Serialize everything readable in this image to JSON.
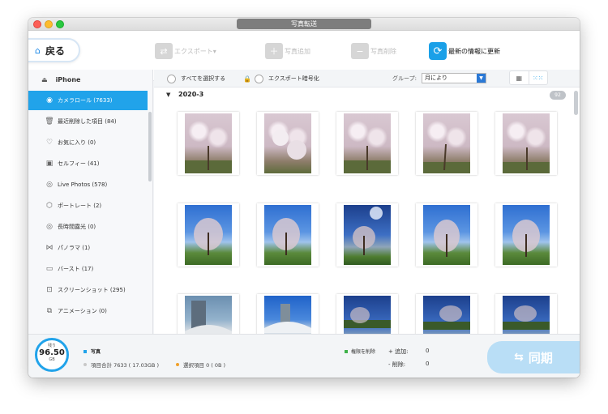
{
  "window": {
    "title": "写真転送"
  },
  "toolbar": {
    "back_label": "戻る",
    "export_label": "エクスポート▾",
    "add_label": "写真追加",
    "delete_label": "写真削除",
    "refresh_label": "最新の情報に更新"
  },
  "sidebar": {
    "device": "iPhone",
    "items": [
      {
        "label": "カメラロール (7633)",
        "icon": "camera-icon",
        "active": true
      },
      {
        "label": "最近削除した項目 (84)",
        "icon": "trash-icon"
      },
      {
        "label": "お気に入り (0)",
        "icon": "heart-icon"
      },
      {
        "label": "セルフィー (41)",
        "icon": "selfie-icon"
      },
      {
        "label": "Live Photos (578)",
        "icon": "live-photo-icon"
      },
      {
        "label": "ポートレート (2)",
        "icon": "cube-icon"
      },
      {
        "label": "長時間露光 (0)",
        "icon": "long-exposure-icon"
      },
      {
        "label": "パノラマ (1)",
        "icon": "panorama-icon"
      },
      {
        "label": "バースト (17)",
        "icon": "burst-icon"
      },
      {
        "label": "スクリーンショット (295)",
        "icon": "screenshot-icon"
      },
      {
        "label": "アニメーション (0)",
        "icon": "animation-icon"
      }
    ]
  },
  "filter": {
    "select_all": "すべてを選択する",
    "export_encrypt": "エクスポート暗号化",
    "group_label": "グループ:",
    "group_value": "月により"
  },
  "gallery": {
    "group_title": "2020-3",
    "group_count": "92"
  },
  "footer": {
    "storage_label": "残り",
    "storage_value": "96.50",
    "storage_unit": "GB",
    "kind": "写真",
    "total": "項目合計 7633 ( 17.03GB )",
    "selected": "選択項目 0 ( 0B )",
    "permission": "権限を削除",
    "add_label": "+ 追加:",
    "add_value": "0",
    "remove_label": "- 削除:",
    "remove_value": "0",
    "sync_label": "同期"
  },
  "colors": {
    "accent": "#21a3ea",
    "sync_button": "#b9def6"
  }
}
